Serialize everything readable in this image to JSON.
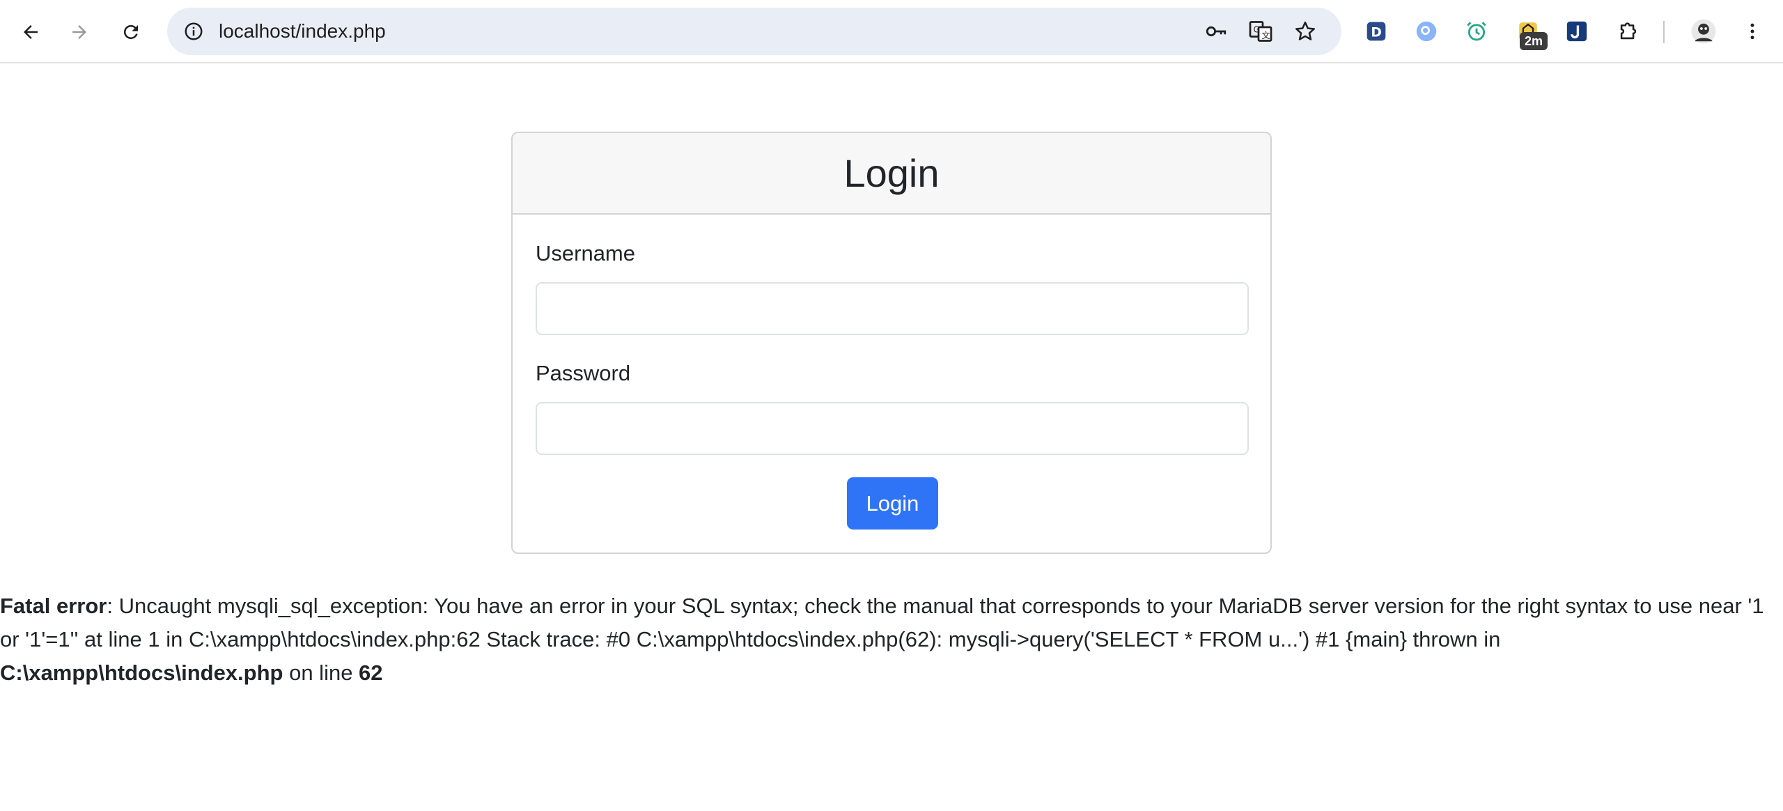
{
  "browser": {
    "url": "localhost/index.php",
    "extension_badge": "2m",
    "nav": {
      "back_icon": "arrow-left-icon",
      "forward_icon": "arrow-right-icon",
      "reload_icon": "reload-icon"
    },
    "omnibox_icons": [
      "key-icon",
      "translate-icon",
      "star-icon"
    ],
    "extensions": [
      "d-extension-icon",
      "search-extension-icon",
      "alarm-extension-icon",
      "timer-extension-icon",
      "j-extension-icon",
      "puzzle-icon"
    ]
  },
  "login": {
    "title": "Login",
    "username_label": "Username",
    "username_value": "",
    "password_label": "Password",
    "password_value": "",
    "button_label": "Login"
  },
  "error": {
    "label": "Fatal error",
    "message": ": Uncaught mysqli_sql_exception: You have an error in your SQL syntax; check the manual that corresponds to your MariaDB server version for the right syntax to use near '1 or '1'=1'' at line 1 in C:\\xampp\\htdocs\\index.php:62 Stack trace: #0 C:\\xampp\\htdocs\\index.php(62): mysqli->query('SELECT * FROM u...') #1 {main} thrown in",
    "file": "C:\\xampp\\htdocs\\index.php",
    "on_line_text": " on line ",
    "line": "62"
  },
  "colors": {
    "primary_button": "#2f74f6",
    "omnibox_bg": "#e9eef6",
    "card_header_bg": "#f7f7f7"
  }
}
